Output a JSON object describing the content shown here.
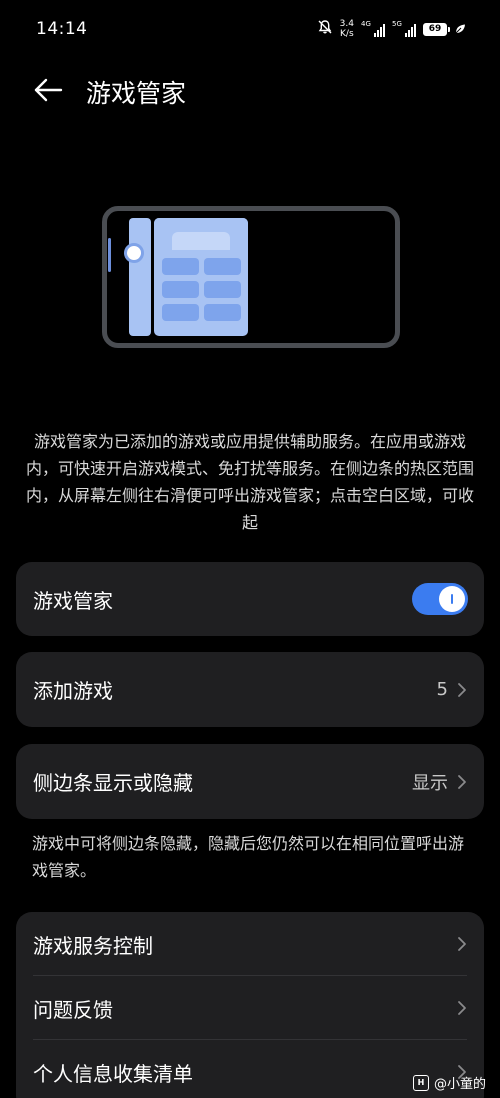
{
  "status_bar": {
    "time": "14:14",
    "net_speed_value": "3.4",
    "net_speed_unit": "K/s",
    "signal1_label": "4G",
    "signal2_label": "5G",
    "battery": "69",
    "icons": [
      "bell-mute-icon",
      "signal-icon",
      "signal-icon",
      "battery-icon",
      "leaf-icon"
    ]
  },
  "header": {
    "title": "游戏管家",
    "back_icon": "arrow-left-icon"
  },
  "description": "游戏管家为已添加的游戏或应用提供辅助服务。在应用或游戏内，可快速开启游戏模式、免打扰等服务。在侧边条的热区范围内，从屏幕左侧往右滑便可呼出游戏管家；点击空白区域，可收起",
  "settings": {
    "game_manager_toggle": {
      "label": "游戏管家",
      "enabled": true
    },
    "add_games": {
      "label": "添加游戏",
      "value": "5"
    },
    "sidebar_visibility": {
      "label": "侧边条显示或隐藏",
      "value": "显示"
    },
    "sidebar_hint": "游戏中可将侧边条隐藏，隐藏后您仍然可以在相同位置呼出游戏管家。",
    "group": [
      {
        "label": "游戏服务控制"
      },
      {
        "label": "问题反馈"
      },
      {
        "label": "个人信息收集清单"
      }
    ]
  },
  "watermark": {
    "text": "@小童的"
  },
  "colors": {
    "background": "#000000",
    "card": "#1f1f21",
    "accent": "#3b7cf0",
    "illustration_blue": "#a8c3f3"
  }
}
